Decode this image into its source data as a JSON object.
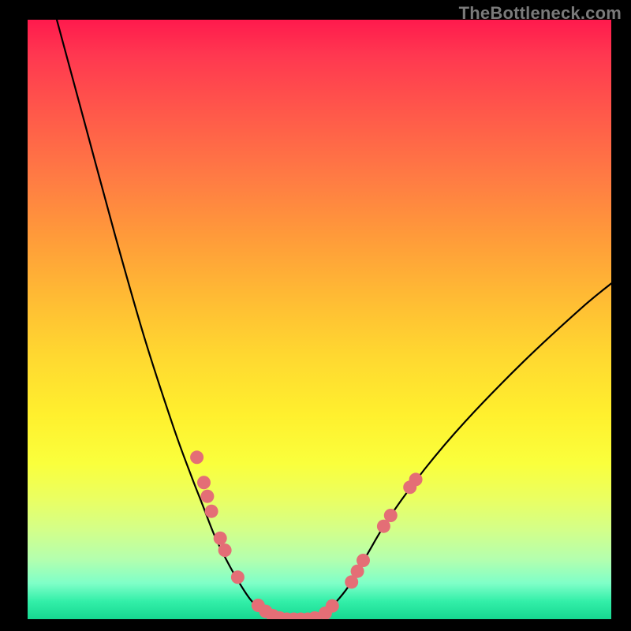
{
  "watermark": "TheBottleneck.com",
  "chart_data": {
    "type": "line",
    "title": "",
    "xlabel": "",
    "ylabel": "",
    "xlim": [
      0,
      100
    ],
    "ylim": [
      0,
      100
    ],
    "axes_visible": false,
    "grid": false,
    "series": [
      {
        "name": "bottleneck-curve-left",
        "x": [
          5,
          10,
          15,
          20,
          25,
          28,
          30,
          32,
          34,
          36,
          38,
          40,
          42
        ],
        "y": [
          100,
          82,
          64,
          47,
          32,
          24,
          19,
          14,
          10,
          6.5,
          3.5,
          1.5,
          0.5
        ]
      },
      {
        "name": "bottleneck-curve-bottom",
        "x": [
          42,
          44,
          46,
          48,
          50
        ],
        "y": [
          0.5,
          0.0,
          0.0,
          0.0,
          0.5
        ]
      },
      {
        "name": "bottleneck-curve-right",
        "x": [
          50,
          52,
          55,
          58,
          62,
          68,
          75,
          85,
          95,
          100
        ],
        "y": [
          0.5,
          2.0,
          5.5,
          10.5,
          17,
          25,
          33,
          43,
          52,
          56
        ]
      }
    ],
    "markers": {
      "name": "sample-points",
      "color": "#e46e76",
      "points": [
        {
          "x": 29.0,
          "y": 27.0
        },
        {
          "x": 30.2,
          "y": 22.8
        },
        {
          "x": 30.8,
          "y": 20.5
        },
        {
          "x": 31.5,
          "y": 18.0
        },
        {
          "x": 33.0,
          "y": 13.5
        },
        {
          "x": 33.8,
          "y": 11.5
        },
        {
          "x": 36.0,
          "y": 7.0
        },
        {
          "x": 39.5,
          "y": 2.3
        },
        {
          "x": 40.8,
          "y": 1.3
        },
        {
          "x": 42.0,
          "y": 0.6
        },
        {
          "x": 43.2,
          "y": 0.2
        },
        {
          "x": 44.4,
          "y": 0.0
        },
        {
          "x": 45.6,
          "y": 0.0
        },
        {
          "x": 46.8,
          "y": 0.0
        },
        {
          "x": 48.0,
          "y": 0.0
        },
        {
          "x": 49.2,
          "y": 0.2
        },
        {
          "x": 51.0,
          "y": 1.0
        },
        {
          "x": 52.2,
          "y": 2.2
        },
        {
          "x": 55.5,
          "y": 6.2
        },
        {
          "x": 56.5,
          "y": 8.0
        },
        {
          "x": 57.5,
          "y": 9.8
        },
        {
          "x": 61.0,
          "y": 15.5
        },
        {
          "x": 62.2,
          "y": 17.3
        },
        {
          "x": 65.5,
          "y": 22.0
        },
        {
          "x": 66.5,
          "y": 23.3
        }
      ]
    },
    "background_gradient": {
      "top": "#ff1a4d",
      "mid": "#fff02e",
      "bottom": "#16d890"
    }
  }
}
